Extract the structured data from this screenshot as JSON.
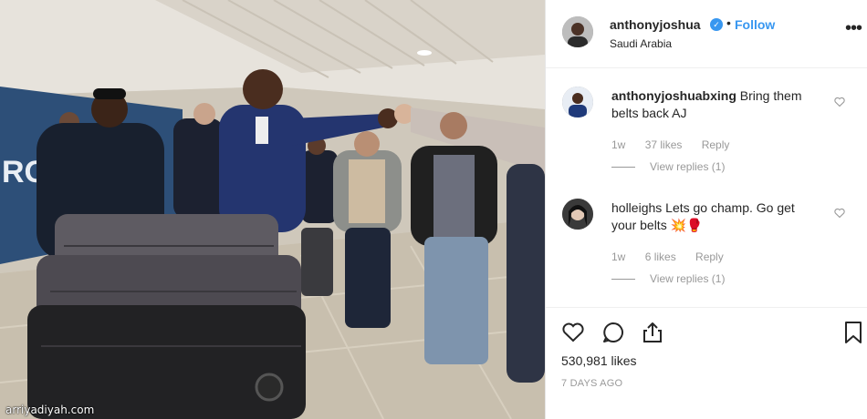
{
  "watermark": "arriyadiyah.com",
  "post": {
    "username": "anthonyjoshua",
    "follow_label": "Follow",
    "separator": "•",
    "location": "Saudi Arabia",
    "more_label": "•••",
    "verified_icon": "check-icon"
  },
  "comments": [
    {
      "username": "anthonyjoshuabxing",
      "text": "Bring them belts back AJ",
      "age": "1w",
      "likes": "37 likes",
      "reply_label": "Reply",
      "view_replies": "View replies (1)"
    },
    {
      "username": "holleighs",
      "text": "Lets go champ. Go get your belts 💥🥊",
      "age": "1w",
      "likes": "6 likes",
      "reply_label": "Reply",
      "view_replies": "View replies (1)"
    }
  ],
  "footer": {
    "likes": "530,981 likes",
    "time_ago": "7 DAYS AGO"
  },
  "colors": {
    "link": "#3897f0",
    "text": "#262626",
    "muted": "#999999"
  }
}
